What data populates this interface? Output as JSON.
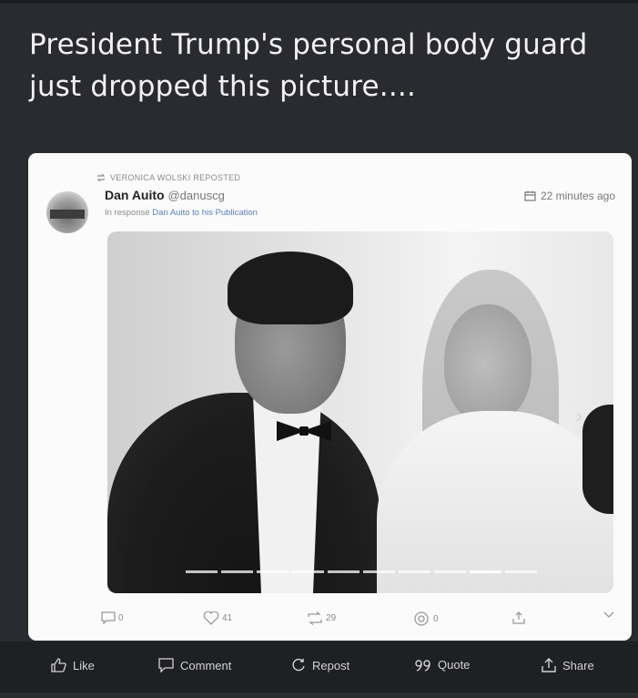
{
  "post": {
    "headline": "President Trump's personal body guard just dropped this picture...."
  },
  "embedded": {
    "repost_label": "VERONICA WOLSKI REPOSTED",
    "author_name": "Dan Auito",
    "author_handle": "@danuscg",
    "in_response_prefix": "In response",
    "in_response_link": "Dan Auito to his Publication",
    "timestamp": "22 minutes ago",
    "actions": {
      "replies": "0",
      "likes": "41",
      "reposts": "29",
      "views": "0"
    },
    "carousel": {
      "total_slides": 10,
      "active_index": 8
    }
  },
  "toolbar": {
    "like": "Like",
    "comment": "Comment",
    "repost": "Repost",
    "quote": "Quote",
    "share": "Share"
  },
  "colors": {
    "background": "#2a2b30",
    "card": "#fbfbfb",
    "toolbar": "#1f2023",
    "link": "#5a7fb8"
  }
}
